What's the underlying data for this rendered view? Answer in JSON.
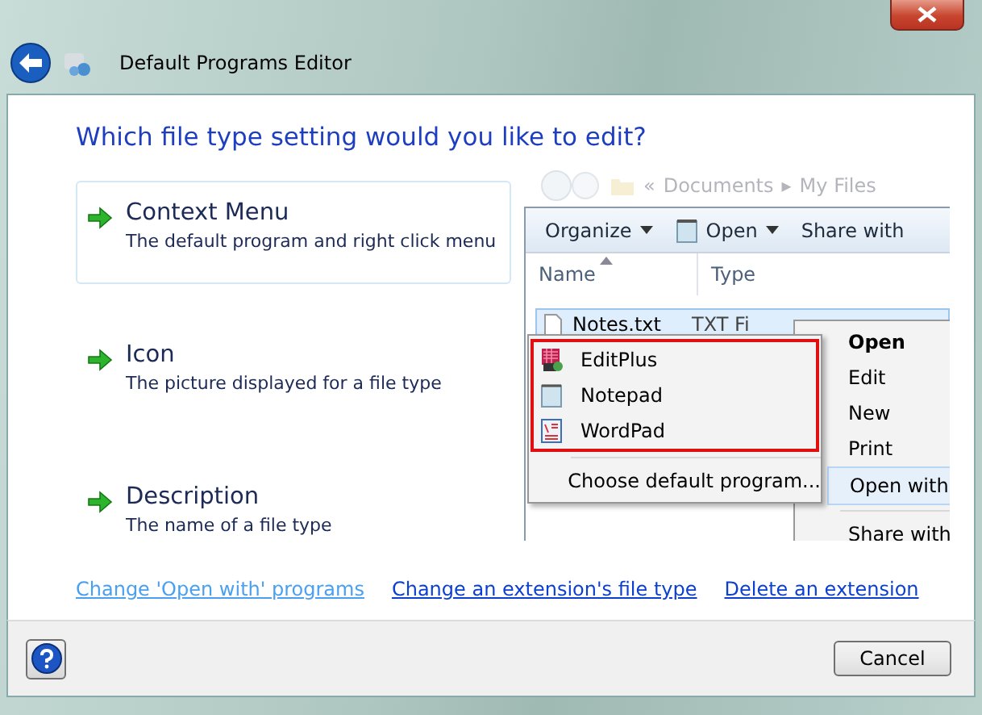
{
  "window": {
    "title": "Default Programs Editor"
  },
  "heading": "Which file type setting would you like to edit?",
  "options": [
    {
      "title": "Context Menu",
      "description": "The default program and right click menu",
      "selected": true
    },
    {
      "title": "Icon",
      "description": "The picture displayed for a file type",
      "selected": false
    },
    {
      "title": "Description",
      "description": "The name of a file type",
      "selected": false
    }
  ],
  "preview": {
    "address": [
      "«",
      "Documents",
      "▸",
      "My Files"
    ],
    "toolbar": [
      {
        "label": "Organize",
        "kind": "menu"
      },
      {
        "label": "Open",
        "kind": "open"
      },
      {
        "label": "Share with",
        "kind": "plain"
      }
    ],
    "columns": [
      "Name",
      "Type"
    ],
    "file": {
      "name": "Notes.txt",
      "type": "TXT Fi"
    },
    "context_menu": [
      {
        "label": "Open",
        "bold": true,
        "selected": false
      },
      {
        "label": "Edit",
        "bold": false,
        "selected": false
      },
      {
        "label": "New",
        "bold": false,
        "selected": false
      },
      {
        "label": "Print",
        "bold": false,
        "selected": false
      },
      {
        "label": "Open with",
        "bold": false,
        "selected": true
      },
      {
        "label": "Share with",
        "bold": false,
        "selected": false
      }
    ],
    "submenu": [
      {
        "label": "EditPlus",
        "kind": "editplus"
      },
      {
        "label": "Notepad",
        "kind": "notepad"
      },
      {
        "label": "WordPad",
        "kind": "wordpad"
      }
    ],
    "submenu_footer": "Choose default program..."
  },
  "links": [
    {
      "label": "Change 'Open with' programs",
      "visited": true
    },
    {
      "label": "Change an extension's file type",
      "visited": false
    },
    {
      "label": "Delete an extension",
      "visited": false
    }
  ],
  "buttons": [
    "Cancel"
  ]
}
